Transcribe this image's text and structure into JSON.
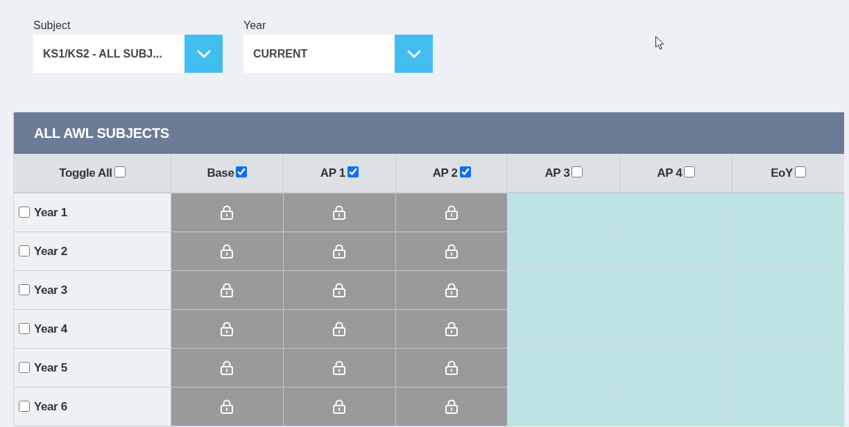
{
  "filters": [
    {
      "label": "Subject",
      "value": "KS1/KS2 - ALL SUBJ..."
    },
    {
      "label": "Year",
      "value": "CURRENT"
    }
  ],
  "table": {
    "title": "ALL AWL SUBJECTS",
    "columns": [
      {
        "label": "Toggle All",
        "checked": false
      },
      {
        "label": "Base",
        "checked": true
      },
      {
        "label": "AP 1",
        "checked": true
      },
      {
        "label": "AP 2",
        "checked": true
      },
      {
        "label": "AP 3",
        "checked": false
      },
      {
        "label": "AP 4",
        "checked": false
      },
      {
        "label": "EoY",
        "checked": false
      }
    ],
    "rows": [
      {
        "label": "Year 1",
        "checked": false,
        "cells": [
          {
            "locked": true
          },
          {
            "locked": true
          },
          {
            "locked": true
          },
          {
            "locked": false
          },
          {
            "locked": false
          },
          {
            "locked": false
          }
        ]
      },
      {
        "label": "Year 2",
        "checked": false,
        "cells": [
          {
            "locked": true
          },
          {
            "locked": true
          },
          {
            "locked": true
          },
          {
            "locked": false
          },
          {
            "locked": false
          },
          {
            "locked": false
          }
        ]
      },
      {
        "label": "Year 3",
        "checked": false,
        "cells": [
          {
            "locked": true
          },
          {
            "locked": true
          },
          {
            "locked": true
          },
          {
            "locked": false
          },
          {
            "locked": false
          },
          {
            "locked": false
          }
        ]
      },
      {
        "label": "Year 4",
        "checked": false,
        "cells": [
          {
            "locked": true
          },
          {
            "locked": true
          },
          {
            "locked": true
          },
          {
            "locked": false
          },
          {
            "locked": false
          },
          {
            "locked": false
          }
        ]
      },
      {
        "label": "Year 5",
        "checked": false,
        "cells": [
          {
            "locked": true
          },
          {
            "locked": true
          },
          {
            "locked": true
          },
          {
            "locked": false
          },
          {
            "locked": false
          },
          {
            "locked": false
          }
        ]
      },
      {
        "label": "Year 6",
        "checked": false,
        "cells": [
          {
            "locked": true
          },
          {
            "locked": true
          },
          {
            "locked": true
          },
          {
            "locked": false
          },
          {
            "locked": false
          },
          {
            "locked": false
          }
        ]
      }
    ]
  }
}
